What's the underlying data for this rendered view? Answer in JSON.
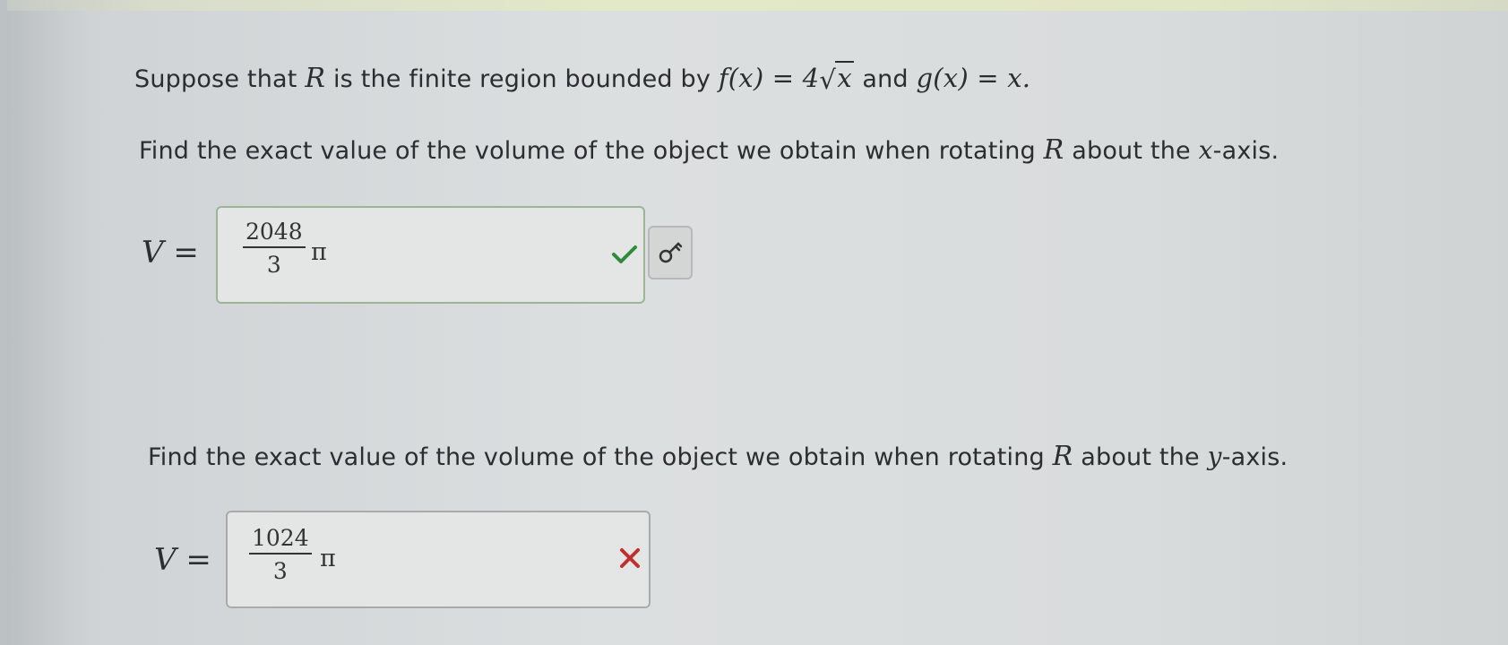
{
  "question": {
    "intro_prefix": "Suppose that",
    "intro_middle": "is the finite region bounded by",
    "intro_and": "and",
    "region": "R",
    "f_name": "f(x) = 4",
    "f_radicand": "x",
    "g_expr": "g(x) = x.",
    "part1_prefix": "Find the exact value of the volume of the object we obtain when rotating",
    "part1_suffix_pre": "about the",
    "part1_axis": "x",
    "part1_suffix_post": "-axis.",
    "part2_prefix": "Find the exact value of the volume of the object we obtain when rotating",
    "part2_suffix_pre": "about the",
    "part2_axis": "y",
    "part2_suffix_post": "-axis."
  },
  "answers": [
    {
      "label_var": "V",
      "label_eq": "=",
      "numerator": "2048",
      "denominator": "3",
      "pi": "π",
      "status": "correct",
      "status_icon": "check-icon",
      "status_color": "#2f8a3a"
    },
    {
      "label_var": "V",
      "label_eq": "=",
      "numerator": "1024",
      "denominator": "3",
      "pi": "π",
      "status": "wrong",
      "status_icon": "x-icon",
      "status_color": "#c0302f"
    }
  ],
  "hint_button": {
    "icon": "key-icon"
  }
}
